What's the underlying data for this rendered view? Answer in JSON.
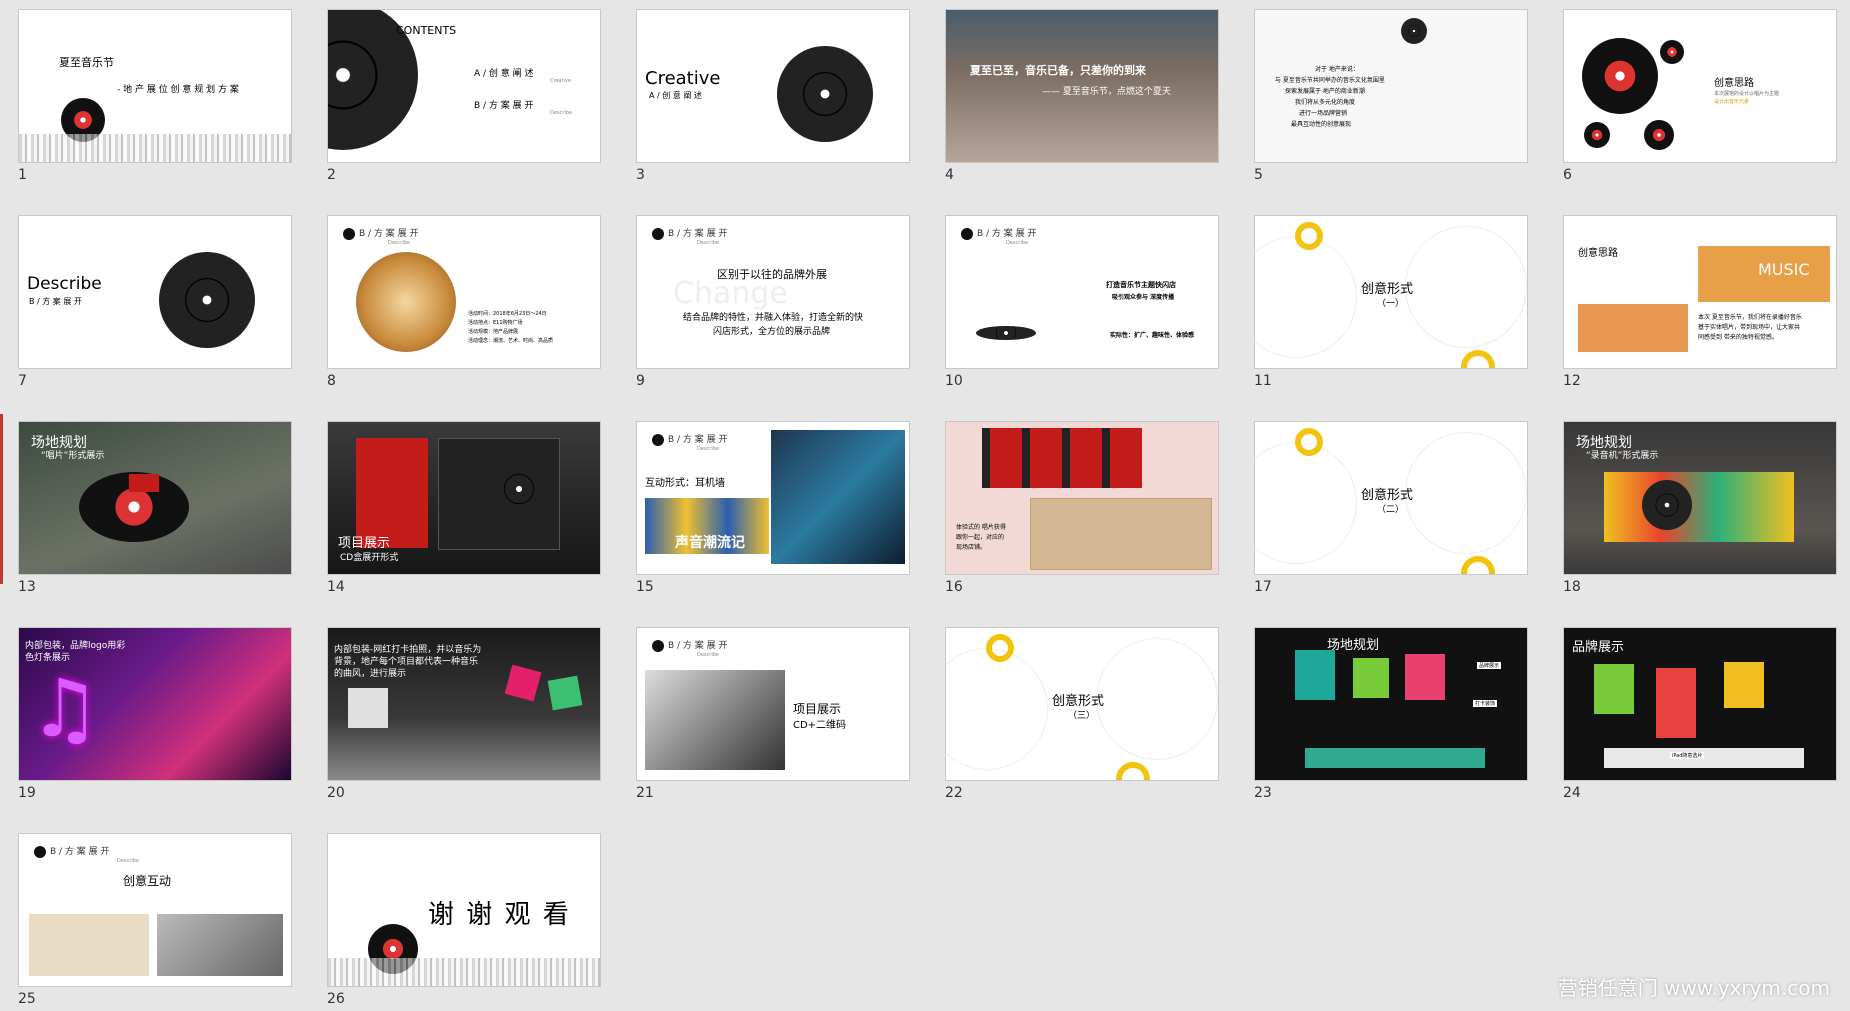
{
  "slides": [
    {
      "num": "1",
      "texts": [
        "夏至音乐节",
        "- 地 产 展 位 创 意 规 划 方 案"
      ]
    },
    {
      "num": "2",
      "texts": [
        "CONTENTS",
        "A / 创 意 阐 述",
        "Creative",
        "B / 方 案 展 开",
        "Describe"
      ]
    },
    {
      "num": "3",
      "texts": [
        "Creative",
        "A / 创 意 阐 述"
      ]
    },
    {
      "num": "4",
      "texts": [
        "夏至已至，音乐已备，只差你的到来",
        "—— 夏至音乐节，点燃这个夏天"
      ]
    },
    {
      "num": "5",
      "texts": [
        "对于 地产来说：",
        "与 夏至音乐节共同举办的音乐文化氛围里",
        "探索发展属于 地产的商业新潮",
        "我们将从多元化的角度",
        "进行一场品牌营销",
        "最具互动性的创意展现"
      ]
    },
    {
      "num": "6",
      "texts": [
        "创意思路",
        "本次展馆的设计以唱片为主题",
        "设计出音乐元素"
      ]
    },
    {
      "num": "7",
      "texts": [
        "Describe",
        "B / 方 案 展 开"
      ]
    },
    {
      "num": "8",
      "texts": [
        "B / 方 案 展 开",
        "Describe",
        "活动时间：2018年6月23日～24日",
        "活动地点：E11购物广场",
        "活动规模：地产品牌展",
        "活动理念：潮流、艺术、时尚、高品质"
      ]
    },
    {
      "num": "9",
      "texts": [
        "B / 方 案 展 开",
        "Describe",
        "区别于以往的品牌外展",
        "Change",
        "结合品牌的特性，并融入体验，打造全新的快",
        "闪店形式，全方位的展示品牌"
      ]
    },
    {
      "num": "10",
      "texts": [
        "B / 方 案 展 开",
        "Describe",
        "打造音乐节主题快闪店",
        "吸引观众参与 深度传播",
        "实际性：扩广、趣味性、体验感"
      ]
    },
    {
      "num": "11",
      "texts": [
        "创意形式",
        "（一）"
      ]
    },
    {
      "num": "12",
      "texts": [
        "创意思路",
        "MUSIC",
        "本次 夏至音乐节，我们将在录播好音乐",
        "基于实体唱片，带到现场中，让大家共",
        "同感受到 带来的独特视觉感。"
      ]
    },
    {
      "num": "13",
      "texts": [
        "场地规划",
        "“唱片”形式展示"
      ]
    },
    {
      "num": "14",
      "texts": [
        "项目展示",
        "CD盒展开形式"
      ]
    },
    {
      "num": "15",
      "texts": [
        "B / 方 案 展 开",
        "Describe",
        "互动形式：耳机墙",
        "声音潮流记"
      ]
    },
    {
      "num": "16",
      "texts": [
        "体验式的 唱片获得",
        "跟你一起，对应的",
        "现场店铺。"
      ]
    },
    {
      "num": "17",
      "texts": [
        "创意形式",
        "（二）"
      ]
    },
    {
      "num": "18",
      "texts": [
        "场地规划",
        "“录音机”形式展示"
      ]
    },
    {
      "num": "19",
      "texts": [
        "内部包装，品牌logo用彩",
        "色灯条展示"
      ]
    },
    {
      "num": "20",
      "texts": [
        "内部包装-网红打卡拍照，并以音乐为",
        "背景，地产每个项目都代表一种音乐",
        "的曲风，进行展示"
      ]
    },
    {
      "num": "21",
      "texts": [
        "B / 方 案 展 开",
        "Describe",
        "项目展示",
        "CD+二维码"
      ]
    },
    {
      "num": "22",
      "texts": [
        "创意形式",
        "（三）"
      ]
    },
    {
      "num": "23",
      "texts": [
        "场地规划",
        "品牌展示",
        "打卡装饰"
      ]
    },
    {
      "num": "24",
      "texts": [
        "品牌展示",
        "iPad随意选片"
      ]
    },
    {
      "num": "25",
      "texts": [
        "B / 方 案 展 开",
        "Describe",
        "创意互动"
      ]
    },
    {
      "num": "26",
      "texts": [
        "谢 谢 观 看"
      ]
    }
  ],
  "watermark": "营销任意门 www.yxrym.com",
  "colors": {
    "background": "#e6e6e6",
    "accent_red": "#c41b1b",
    "accent_yellow": "#f1c40f"
  }
}
